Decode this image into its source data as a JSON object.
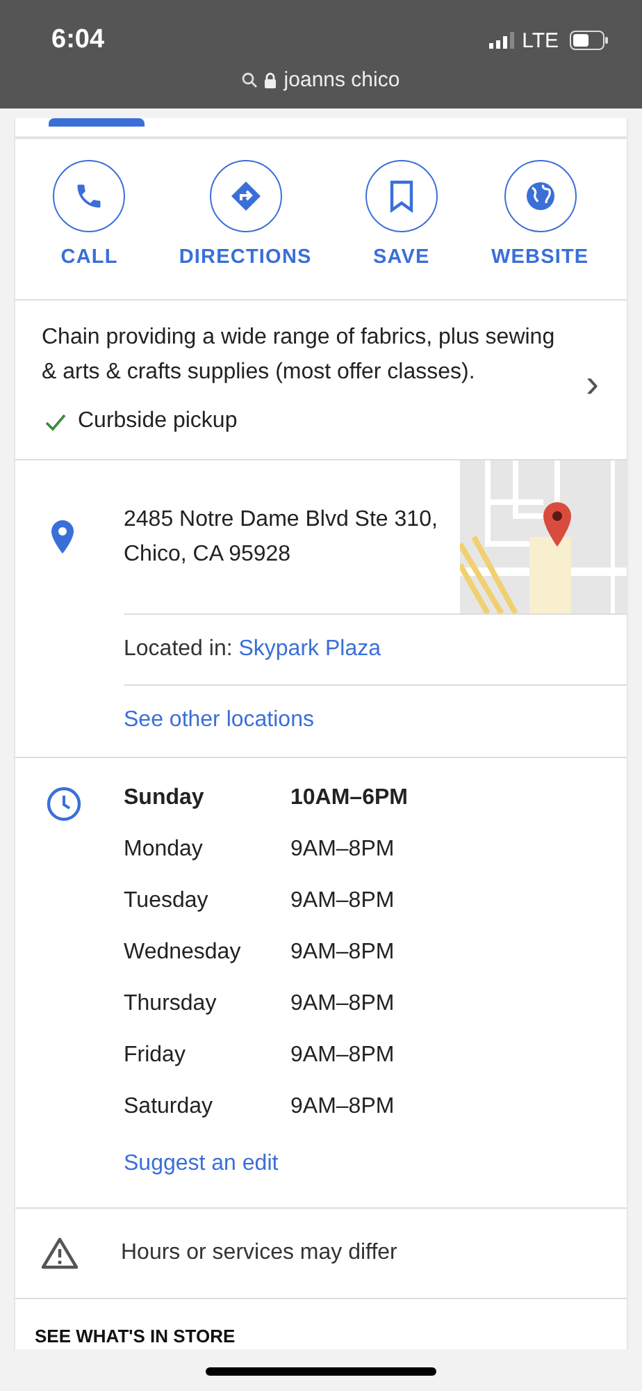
{
  "status_bar": {
    "time": "6:04",
    "network": "LTE"
  },
  "address_bar": {
    "text": "joanns chico"
  },
  "actions": [
    {
      "kind": "call",
      "label": "CALL"
    },
    {
      "kind": "directions",
      "label": "DIRECTIONS"
    },
    {
      "kind": "save",
      "label": "SAVE"
    },
    {
      "kind": "website",
      "label": "WEBSITE"
    }
  ],
  "description": {
    "text": "Chain providing a wide range of fabrics, plus sewing & arts & crafts supplies (most offer classes).",
    "arrow": "›",
    "feature": "Curbside pickup"
  },
  "address": {
    "text": "2485 Notre Dame Blvd Ste 310, Chico, CA 95928"
  },
  "located_in": {
    "label": "Located in:",
    "place": "Skypark Plaza"
  },
  "other_locations": "See other locations",
  "hours": [
    {
      "day": "Sunday",
      "time": "10AM–6PM",
      "today": true
    },
    {
      "day": "Monday",
      "time": "9AM–8PM",
      "today": false
    },
    {
      "day": "Tuesday",
      "time": "9AM–8PM",
      "today": false
    },
    {
      "day": "Wednesday",
      "time": "9AM–8PM",
      "today": false
    },
    {
      "day": "Thursday",
      "time": "9AM–8PM",
      "today": false
    },
    {
      "day": "Friday",
      "time": "9AM–8PM",
      "today": false
    },
    {
      "day": "Saturday",
      "time": "9AM–8PM",
      "today": false
    }
  ],
  "suggest_edit": "Suggest an edit",
  "notice": "Hours or services may differ",
  "next_section": "SEE WHAT'S IN STORE"
}
